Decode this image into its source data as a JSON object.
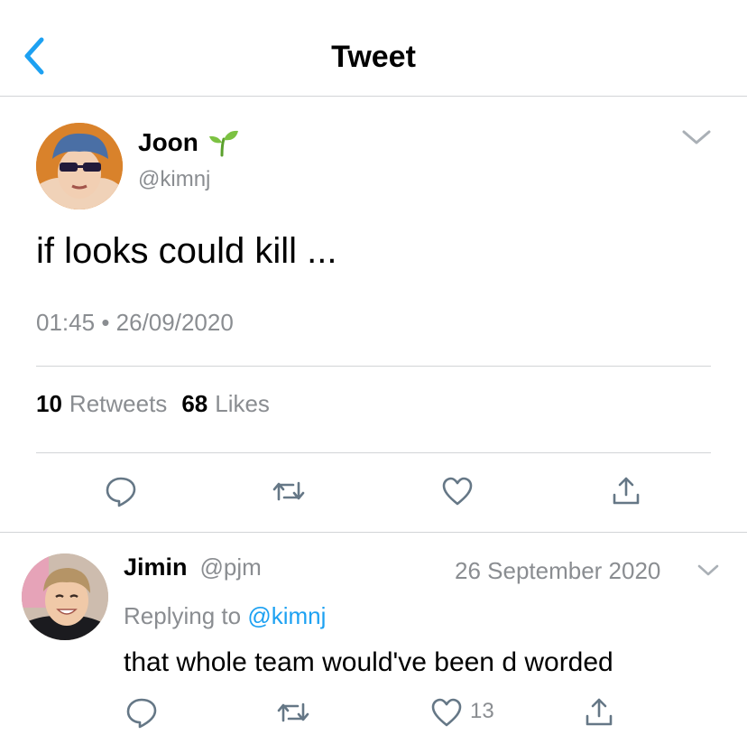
{
  "header": {
    "title": "Tweet",
    "back_icon": "chevron-left-icon"
  },
  "tweet": {
    "author_name": "Joon",
    "author_emoji": "seedling-icon",
    "author_handle": "@kimnj",
    "text": "if looks could kill ...",
    "time": "01:45",
    "separator": "•",
    "date": "26/09/2020",
    "retweets_count": "10",
    "retweets_label": "Retweets",
    "likes_count": "68",
    "likes_label": "Likes",
    "actions": [
      "reply-icon",
      "retweet-icon",
      "heart-icon",
      "share-icon"
    ]
  },
  "reply": {
    "author_name": "Jimin",
    "author_handle": "@pjm",
    "date": "26 September 2020",
    "replying_prefix": "Replying to",
    "replying_to": "@kimnj",
    "text": "that whole team would've been d worded",
    "like_count": "13",
    "actions": [
      "reply-icon",
      "retweet-icon",
      "heart-icon",
      "share-icon"
    ]
  },
  "colors": {
    "accent": "#1da1f2",
    "muted": "#8a8d91",
    "divider": "#d2d4d7",
    "leaf": "#7cc242"
  }
}
